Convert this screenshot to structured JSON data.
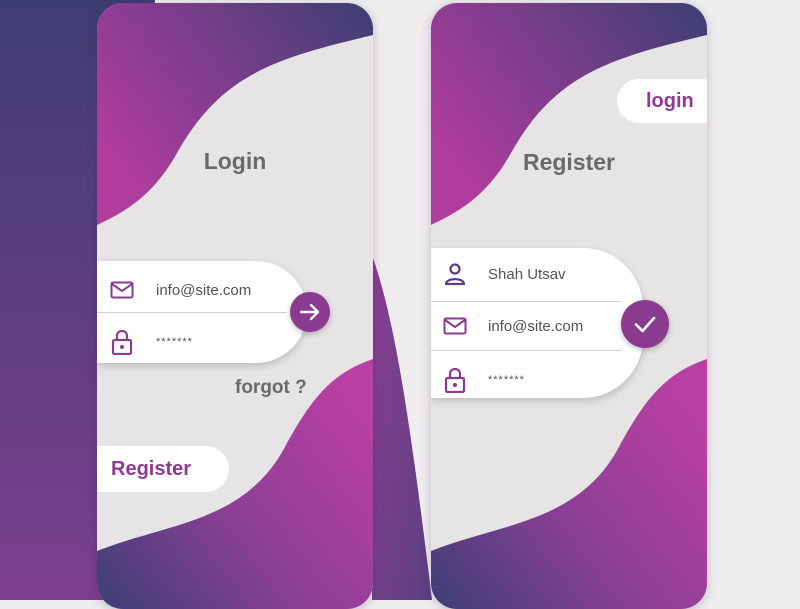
{
  "colors": {
    "gradient_start": "#b03c9e",
    "gradient_end": "#3c3f74",
    "accent": "#8a3a8f",
    "card_bg": "#e6e4e5",
    "page_bg": "#efedee"
  },
  "login_screen": {
    "title": "Login",
    "email": {
      "icon": "mail-icon",
      "value": "info@site.com"
    },
    "password": {
      "icon": "lock-icon",
      "value": "*******"
    },
    "submit_icon": "arrow-right-icon",
    "forgot_label": "forgot ?",
    "register_button": "Register"
  },
  "register_screen": {
    "login_button": "login",
    "title": "Register",
    "name": {
      "icon": "user-icon",
      "value": "Shah Utsav"
    },
    "email": {
      "icon": "mail-icon",
      "value": "info@site.com"
    },
    "password": {
      "icon": "lock-icon",
      "value": "*******"
    },
    "submit_icon": "check-icon"
  }
}
